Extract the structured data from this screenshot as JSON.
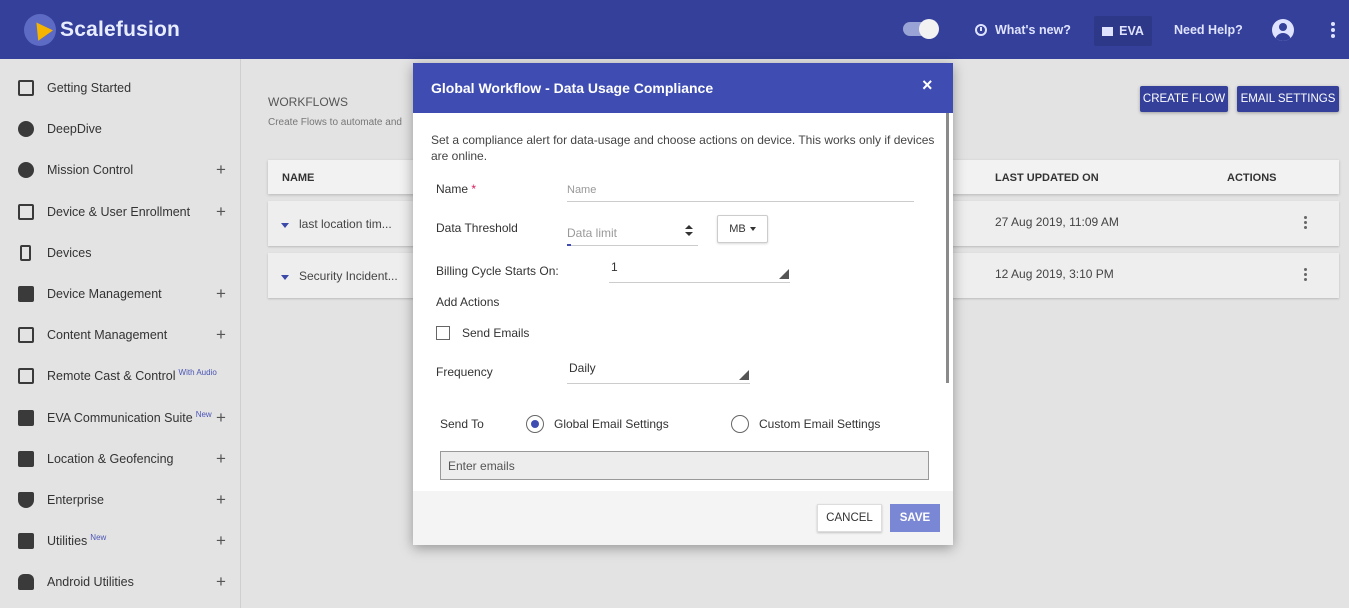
{
  "header": {
    "brand": "Scalefusion",
    "whats_new": "What's new?",
    "eva": "EVA",
    "need_help": "Need Help?"
  },
  "sidebar": {
    "items": [
      {
        "label": "Getting Started",
        "sup": "",
        "expandable": false,
        "icon": "enter-icon"
      },
      {
        "label": "DeepDive",
        "sup": "",
        "expandable": false,
        "icon": "gauge-icon"
      },
      {
        "label": "Mission Control",
        "sup": "",
        "expandable": true,
        "icon": "mission-control-icon"
      },
      {
        "label": "Device & User Enrollment",
        "sup": "",
        "expandable": true,
        "icon": "devices-icon"
      },
      {
        "label": "Devices",
        "sup": "",
        "expandable": false,
        "icon": "phone-icon"
      },
      {
        "label": "Device Management",
        "sup": "",
        "expandable": true,
        "icon": "briefcase-icon"
      },
      {
        "label": "Content Management",
        "sup": "",
        "expandable": true,
        "icon": "folder-icon"
      },
      {
        "label": "Remote Cast & Control",
        "sup": "With Audio",
        "expandable": false,
        "icon": "cast-icon"
      },
      {
        "label": "EVA Communication Suite",
        "sup": "New",
        "expandable": true,
        "icon": "chat-icon"
      },
      {
        "label": "Location & Geofencing",
        "sup": "",
        "expandable": true,
        "icon": "map-icon"
      },
      {
        "label": "Enterprise",
        "sup": "",
        "expandable": true,
        "icon": "shield-icon"
      },
      {
        "label": "Utilities",
        "sup": "New",
        "expandable": true,
        "icon": "widgets-icon"
      },
      {
        "label": "Android Utilities",
        "sup": "",
        "expandable": true,
        "icon": "android-icon"
      }
    ]
  },
  "main": {
    "title": "WORKFLOWS",
    "subtitle": "Create Flows to automate and",
    "create_flow": "CREATE FLOW",
    "email_settings": "EMAIL SETTINGS",
    "columns": [
      "NAME",
      "LAST UPDATED ON",
      "ACTIONS"
    ],
    "rows": [
      {
        "name": "last location tim...",
        "updated": "27 Aug 2019, 11:09 AM"
      },
      {
        "name": "Security Incident...",
        "updated": "12 Aug 2019, 3:10 PM"
      }
    ]
  },
  "modal": {
    "title": "Global Workflow - Data Usage Compliance",
    "close": "×",
    "description": "Set a compliance alert for data-usage and choose actions on device. This works only if devices are online.",
    "name_label": "Name",
    "name_required": "*",
    "name_placeholder": "Name",
    "threshold_label": "Data Threshold",
    "threshold_placeholder": "Data limit",
    "unit": "MB",
    "billing_label": "Billing Cycle Starts On:",
    "billing_value": "1",
    "add_actions": "Add Actions",
    "send_emails": "Send Emails",
    "frequency_label": "Frequency",
    "frequency_value": "Daily",
    "send_to": "Send To",
    "global_email": "Global Email Settings",
    "custom_email": "Custom Email Settings",
    "emails_placeholder": "Enter emails",
    "cancel": "CANCEL",
    "save": "SAVE"
  }
}
